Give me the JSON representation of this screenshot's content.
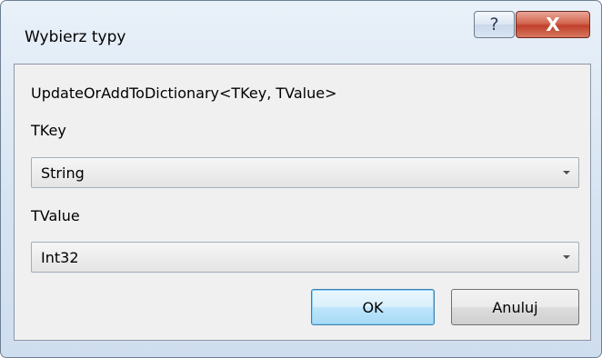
{
  "window": {
    "title": "Wybierz typy",
    "help_label": "?",
    "close_label": "X"
  },
  "dialog": {
    "method_signature": "UpdateOrAddToDictionary<TKey, TValue>",
    "tkey_label": "TKey",
    "tkey_value": "String",
    "tvalue_label": "TValue",
    "tvalue_value": "Int32",
    "ok_label": "OK",
    "cancel_label": "Anuluj"
  },
  "icons": {
    "help": "question-mark-icon",
    "close": "close-icon",
    "dropdown": "chevron-down-icon"
  },
  "colors": {
    "close_button": "#c75a44",
    "ok_button_border": "#3c7fb1",
    "window_frame": "#d5e3f2",
    "client_background": "#f0f0f0"
  }
}
